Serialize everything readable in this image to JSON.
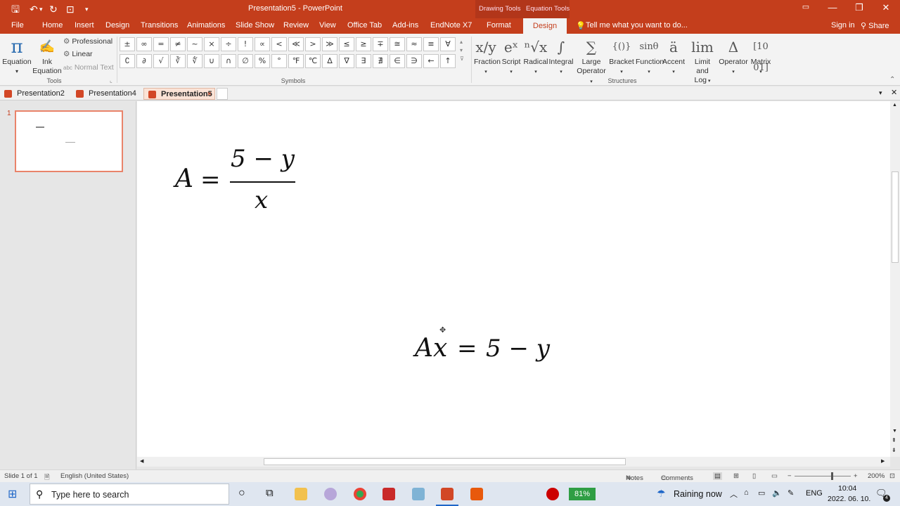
{
  "window": {
    "title": "Presentation5 - PowerPoint",
    "context_groups": [
      "Drawing Tools",
      "Equation Tools"
    ]
  },
  "ribbon_tabs": [
    "File",
    "Home",
    "Insert",
    "Design",
    "Transitions",
    "Animations",
    "Slide Show",
    "Review",
    "View",
    "Office Tab",
    "Add-ins",
    "EndNote X7",
    "Format",
    "Design"
  ],
  "tell_me": "Tell me what you want to do...",
  "account": {
    "sign_in": "Sign in",
    "share": "Share"
  },
  "tools_group": {
    "label": "Tools",
    "equation": "Equation",
    "ink_line1": "Ink",
    "ink_line2": "Equation",
    "professional": "Professional",
    "linear": "Linear",
    "normal_text": "Normal Text",
    "abc": "abc"
  },
  "symbols_group": {
    "label": "Symbols",
    "row1": [
      "±",
      "∞",
      "=",
      "≠",
      "~",
      "×",
      "÷",
      "!",
      "∝",
      "<",
      "≪",
      ">",
      "≫",
      "≤",
      "≥",
      "∓",
      "≅",
      "≈",
      "≡",
      "∀"
    ],
    "row2": [
      "∁",
      "∂",
      "√",
      "∛",
      "∜",
      "∪",
      "∩",
      "∅",
      "%",
      "°",
      "℉",
      "℃",
      "∆",
      "∇",
      "∃",
      "∄",
      "∈",
      "∋",
      "←",
      "↑"
    ]
  },
  "structures_group": {
    "label": "Structures",
    "items": [
      {
        "icon": "x/y",
        "line1": "Fraction",
        "line2": ""
      },
      {
        "icon": "eˣ",
        "line1": "Script",
        "line2": ""
      },
      {
        "icon": "ⁿ√x",
        "line1": "Radical",
        "line2": ""
      },
      {
        "icon": "∫",
        "line1": "Integral",
        "line2": ""
      },
      {
        "icon": "∑",
        "line1": "Large",
        "line2": "Operator"
      },
      {
        "icon": "{()}",
        "line1": "Bracket",
        "line2": ""
      },
      {
        "icon": "sinθ",
        "line1": "Function",
        "line2": ""
      },
      {
        "icon": "ä",
        "line1": "Accent",
        "line2": ""
      },
      {
        "icon": "lim",
        "line1": "Limit and",
        "line2": "Log"
      },
      {
        "icon": "Δ",
        "line1": "Operator",
        "line2": ""
      },
      {
        "icon": "[10 01]",
        "line1": "Matrix",
        "line2": ""
      }
    ]
  },
  "doc_tabs": [
    "Presentation2",
    "Presentation4",
    "Presentation5"
  ],
  "slide_number": "1",
  "equations": {
    "eq1": {
      "lhs": "A",
      "eq": "=",
      "num": "5 − y",
      "den": "x"
    },
    "eq2": {
      "text_a": "Ax",
      "eq": "=",
      "rhs": "5 − y"
    }
  },
  "status": {
    "slide": "Slide 1 of 1",
    "language": "English (United States)",
    "notes": "Notes",
    "comments": "Comments",
    "zoom": "200%"
  },
  "taskbar": {
    "search_placeholder": "Type here to search",
    "battery": "81%",
    "weather": "Raining now",
    "lang": "ENG",
    "time": "10:04",
    "date": "2022. 06. 10.",
    "notifications": "4"
  }
}
